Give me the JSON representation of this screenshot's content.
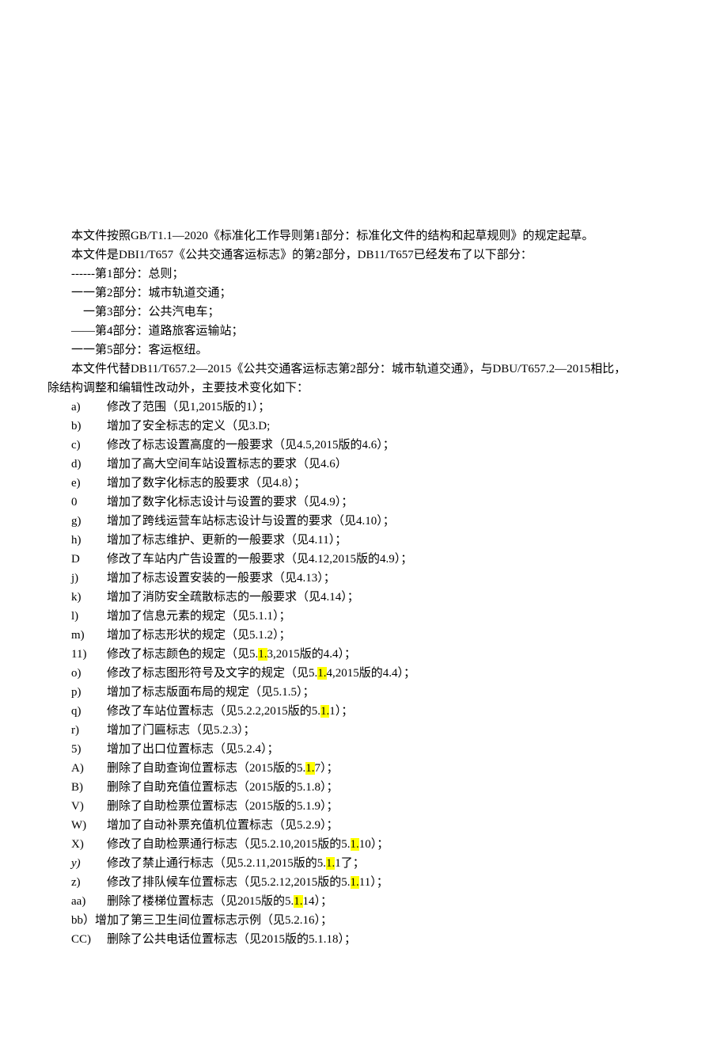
{
  "intro": {
    "line1": "本文件按照GB/T1.1—2020《标准化工作导则第1部分：标准化文件的结构和起草规则》的规定起草。",
    "line2": "本文件是DBI1/T657《公共交通客运标志》的第2部分，DB11/T657已经发布了以下部分：",
    "part1": "------第1部分：总则；",
    "part2": "一一第2部分：城市轨道交通；",
    "part3": "一第3部分：公共汽电车；",
    "part4": "——第4部分：道路旅客运输站；",
    "part5": "一一第5部分：客运枢纽。",
    "replace1": "本文件代替DB11/T657.2—2015《公共交通客运标志第2部分：城市轨道交通》，与DBU/T657.2—2015相比，",
    "replace2": "除结构调整和编辑性改动外，主要技术变化如下："
  },
  "items": [
    {
      "marker": "a)",
      "text": "修改了范围（见1,2015版的1）；"
    },
    {
      "marker": "b)",
      "text": "增加了安全标志的定义（见3.D;"
    },
    {
      "marker": "c)",
      "text": "修改了标志设置高度的一般要求（见4.5,2015版的4.6）；"
    },
    {
      "marker": "d)",
      "text": "增加了高大空间车站设置标志的要求（见4.6）"
    },
    {
      "marker": "e)",
      "text": "增加了数字化标志的股要求（见4.8）；"
    },
    {
      "marker": "0",
      "text": "增加了数字化标志设计与设置的要求（见4.9）；"
    },
    {
      "marker": "g)",
      "text": "增加了跨线运营车站标志设计与设置的要求（见4.10）；"
    },
    {
      "marker": "h)",
      "text": "增加了标志维护、更新的一般要求（见4.11）；"
    },
    {
      "marker": "D",
      "text": "修改了车站内广告设置的一般要求（见4.12,2015版的4.9）；"
    },
    {
      "marker": "j)",
      "text": "增加了标志设置安装的一般要求（见4.13）；"
    },
    {
      "marker": "k)",
      "text": "增加了消防安全疏散标志的一般要求（见4.14）；"
    },
    {
      "marker": "l)",
      "text": "增加了信息元素的规定（见5.1.1）；"
    },
    {
      "marker": "m)",
      "text": "增加了标志形状的规定（见5.1.2）；"
    },
    {
      "marker": "11)",
      "pre": "修改了标志颜色的规定（见5.",
      "hl": "1.",
      "post": "3,2015版的4.4）；"
    },
    {
      "marker": "o)",
      "pre": "修改了标志图形符号及文字的规定（见5.",
      "hl": "1.",
      "post": "4,2015版的4.4）；"
    },
    {
      "marker": "p)",
      "text": "增加了标志版面布局的规定（见5.1.5）；"
    },
    {
      "marker": "q)",
      "pre": "修改了车站位置标志（见5.2.2,2015版的5.",
      "hl": "1.",
      "post": "1）；"
    },
    {
      "marker": "r)",
      "text": "增加了门匾标志（见5.2.3）；"
    },
    {
      "marker": "5)",
      "text": "增加了出口位置标志（见5.2.4）；"
    },
    {
      "marker": "A)",
      "pre": "删除了自助查询位置标志（2015版的5.",
      "hl": "1.",
      "post": "7）；"
    },
    {
      "marker": "B)",
      "text": "删除了自助充值位置标志（2015版的5.1.8）；"
    },
    {
      "marker": "V)",
      "text": "删除了自助检票位置标志（2015版的5.1.9）；"
    },
    {
      "marker": "W)",
      "text": "增加了自动补票充值机位置标志（见5.2.9）；"
    },
    {
      "marker": "X)",
      "pre": "修改了自助检票通行标志（见5.2.10,2015版的5.",
      "hl": "1.",
      "post": "10）；"
    },
    {
      "marker": "y)",
      "pre": "修改了禁止通行标志（见5.2.11,2015版的5.",
      "hl": "1.",
      "post": "1了；",
      "italic": true
    },
    {
      "marker": "z)",
      "pre": "修改了排队候车位置标志（见5.2.12,2015版的5.",
      "hl": "1.",
      "post": "11）；"
    },
    {
      "marker": "aa)",
      "pre": "删除了楼梯位置标志（见2015版的5.",
      "hl": "1.",
      "post": "14）；"
    },
    {
      "marker": "bb）",
      "text": "增加了第三卫生间位置标志示例（见5.2.16）；",
      "tight": true
    },
    {
      "marker": "CC)",
      "text": "删除了公共电话位置标志（见2015版的5.1.18）；"
    }
  ]
}
